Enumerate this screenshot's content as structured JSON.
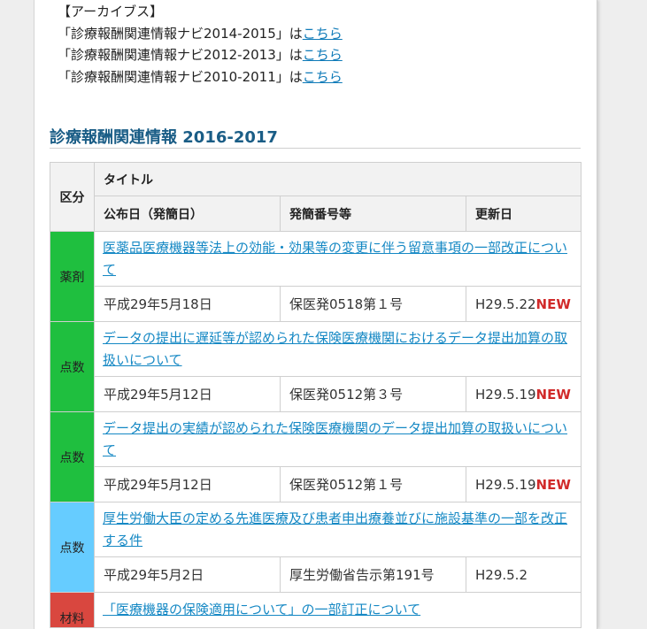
{
  "archive": {
    "heading": "【アーカイブス】",
    "items": [
      {
        "text": "「診療報酬関連情報ナビ2014-2015」は",
        "link": "こちら"
      },
      {
        "text": "「診療報酬関連情報ナビ2012-2013」は",
        "link": "こちら"
      },
      {
        "text": "「診療報酬関連情報ナビ2010-2011」は",
        "link": "こちら"
      }
    ]
  },
  "section_title": "診療報酬関連情報 2016-2017",
  "table": {
    "headers": {
      "category": "区分",
      "title": "タイトル",
      "date": "公布日（発簡日）",
      "number": "発簡番号等",
      "updated": "更新日"
    },
    "rows": [
      {
        "category": "薬剤",
        "color": "#1fbf3f",
        "title": "医薬品医療機器等法上の効能・効果等の変更に伴う留意事項の一部改正について",
        "date": "平成29年5月18日",
        "number": "保医発0518第１号",
        "updated": "H29.5.22",
        "new": "NEW"
      },
      {
        "category": "点数",
        "color": "#1fbf3f",
        "title": "データの提出に遅延等が認められた保険医療機関におけるデータ提出加算の取扱いについて",
        "date": "平成29年5月12日",
        "number": "保医発0512第３号",
        "updated": "H29.5.19",
        "new": "NEW"
      },
      {
        "category": "点数",
        "color": "#1fbf3f",
        "title": "データ提出の実績が認められた保険医療機関のデータ提出加算の取扱いについて",
        "date": "平成29年5月12日",
        "number": "保医発0512第１号",
        "updated": "H29.5.19",
        "new": "NEW"
      },
      {
        "category": "点数",
        "color": "#66ccff",
        "title": "厚生労働大臣の定める先進医療及び患者申出療養並びに施設基準の一部を改正する件",
        "date": "平成29年5月2日",
        "number": "厚生労働省告示第191号",
        "updated": "H29.5.2",
        "new": ""
      },
      {
        "category": "材料",
        "color": "#d9473f",
        "title": "「医療機器の保険適用について」の一部訂正について",
        "date": "",
        "number": "",
        "updated": "",
        "new": ""
      }
    ]
  }
}
